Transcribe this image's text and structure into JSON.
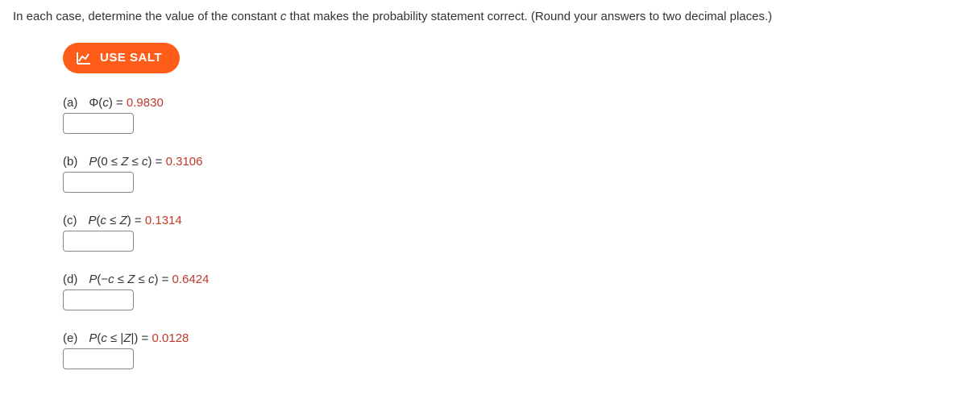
{
  "instruction_prefix": "In each case, determine the value of the constant ",
  "instruction_var": "c",
  "instruction_suffix": " that makes the probability statement correct. (Round your answers to two decimal places.)",
  "salt_button": "USE SALT",
  "problems": {
    "a": {
      "label": "(a)",
      "expr_prefix": "Φ(",
      "expr_var": "c",
      "expr_suffix": ") = ",
      "value": "0.9830"
    },
    "b": {
      "label": "(b)",
      "expr_prefix": "P",
      "expr_inner_prefix": "(0 ≤ ",
      "expr_z": "Z",
      "expr_inner_mid": " ≤ ",
      "expr_c": "c",
      "expr_suffix": ") = ",
      "value": "0.3106"
    },
    "c": {
      "label": "(c)",
      "expr_prefix": "P",
      "expr_inner_prefix": "(",
      "expr_c": "c",
      "expr_inner_mid": " ≤ ",
      "expr_z": "Z",
      "expr_suffix": ") = ",
      "value": "0.1314"
    },
    "d": {
      "label": "(d)",
      "expr_prefix": "P",
      "expr_inner_prefix": "(−",
      "expr_c1": "c",
      "expr_inner_mid1": " ≤ ",
      "expr_z": "Z",
      "expr_inner_mid2": " ≤ ",
      "expr_c2": "c",
      "expr_suffix": ") = ",
      "value": "0.6424"
    },
    "e": {
      "label": "(e)",
      "expr_prefix": "P",
      "expr_inner_prefix": "(",
      "expr_c": "c",
      "expr_inner_mid": " ≤ |",
      "expr_z": "Z",
      "expr_suffix": "|) = ",
      "value": "0.0128"
    }
  }
}
